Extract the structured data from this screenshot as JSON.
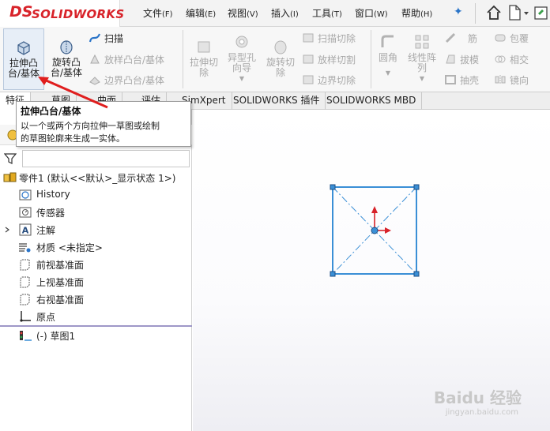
{
  "app": {
    "logo_mark": "DS",
    "logo_text": "SOLIDWORKS"
  },
  "menu": [
    {
      "label": "文件",
      "key": "(F)"
    },
    {
      "label": "编辑",
      "key": "(E)"
    },
    {
      "label": "视图",
      "key": "(V)"
    },
    {
      "label": "插入",
      "key": "(I)"
    },
    {
      "label": "工具",
      "key": "(T)"
    },
    {
      "label": "窗口",
      "key": "(W)"
    },
    {
      "label": "帮助",
      "key": "(H)"
    }
  ],
  "ribbon": {
    "extrude_boss": "拉伸凸\n台/基体",
    "revolve_boss": "旋转凸\n台/基体",
    "sweep": "扫描",
    "loft": "放样凸台/基体",
    "boundary": "边界凸台/基体",
    "extrude_cut": "拉伸切\n除",
    "hole_wizard": "异型孔\n向导",
    "revolve_cut": "旋转切\n除",
    "swept_cut": "扫描切除",
    "lofted_cut": "放样切割",
    "boundary_cut": "边界切除",
    "fillet": "圆角",
    "linear_pattern": "线性阵\n列",
    "rib": "筋",
    "draft": "拔模",
    "shell": "抽壳",
    "wrap": "包覆",
    "intersect": "相交",
    "mirror": "镜向"
  },
  "tabs": [
    "特征",
    "草图",
    "曲面",
    "评估",
    "SimXpert",
    "SOLIDWORKS 插件",
    "SOLIDWORKS MBD"
  ],
  "tooltip": {
    "title": "拉伸凸台/基体",
    "desc_line1": "以一个或两个方向拉伸一草图或绘制",
    "desc_line2": "的草图轮廓来生成一实体。"
  },
  "tree": {
    "root": "零件1  (默认<<默认>_显示状态 1>)",
    "items": [
      {
        "label": "History",
        "icon": "history-icon"
      },
      {
        "label": "传感器",
        "icon": "sensor-icon"
      },
      {
        "label": "注解",
        "icon": "annotation-icon"
      },
      {
        "label": "材质 <未指定>",
        "icon": "material-icon"
      },
      {
        "label": "前视基准面",
        "icon": "plane-icon"
      },
      {
        "label": "上视基准面",
        "icon": "plane-icon"
      },
      {
        "label": "右视基准面",
        "icon": "plane-icon"
      },
      {
        "label": "原点",
        "icon": "origin-icon"
      }
    ],
    "sketch": "(-) 草图1"
  },
  "watermark": {
    "brand": "Baidu 经验",
    "url": "jingyan.baidu.com"
  },
  "colors": {
    "accent_red": "#d8232a",
    "sketch_blue": "#3a8fd6",
    "selection_purple": "#9e97c8"
  }
}
